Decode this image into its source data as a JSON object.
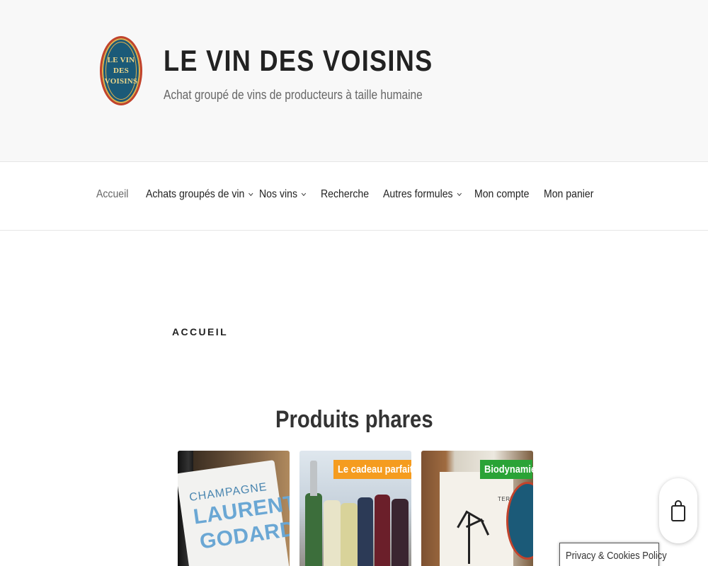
{
  "header": {
    "logo_lines": [
      "LE VIN",
      "DES",
      "VOISINS"
    ],
    "site_title": "LE VIN DES VOISINS",
    "tagline": "Achat groupé de vins de producteurs à taille humaine"
  },
  "nav": {
    "items": [
      {
        "label": "Accueil",
        "current": true,
        "dropdown": false
      },
      {
        "label": "Achats groupés de vin",
        "current": false,
        "dropdown": true
      },
      {
        "label": "Nos vins",
        "current": false,
        "dropdown": true
      },
      {
        "label": "Recherche",
        "current": false,
        "dropdown": false
      },
      {
        "label": "Autres formules",
        "current": false,
        "dropdown": true
      },
      {
        "label": "Mon compte",
        "current": false,
        "dropdown": false
      },
      {
        "label": "Mon panier",
        "current": false,
        "dropdown": false
      }
    ]
  },
  "content": {
    "page_title": "ACCUEIL",
    "section_title": "Produits phares",
    "products": [
      {
        "label_text": [
          "CHAMPAGNE",
          "LAURENT",
          "GODARD"
        ],
        "badge": null
      },
      {
        "badge": "Le cadeau parfait !",
        "badge_color": "#f59c1f"
      },
      {
        "label_text": [
          "TERROIR"
        ],
        "badge": "Biodynamie",
        "badge_color": "#2aa336"
      }
    ]
  },
  "cart": {
    "icon": "shopping-bag-icon"
  },
  "privacy": {
    "label": "Privacy & Cookies Policy"
  }
}
